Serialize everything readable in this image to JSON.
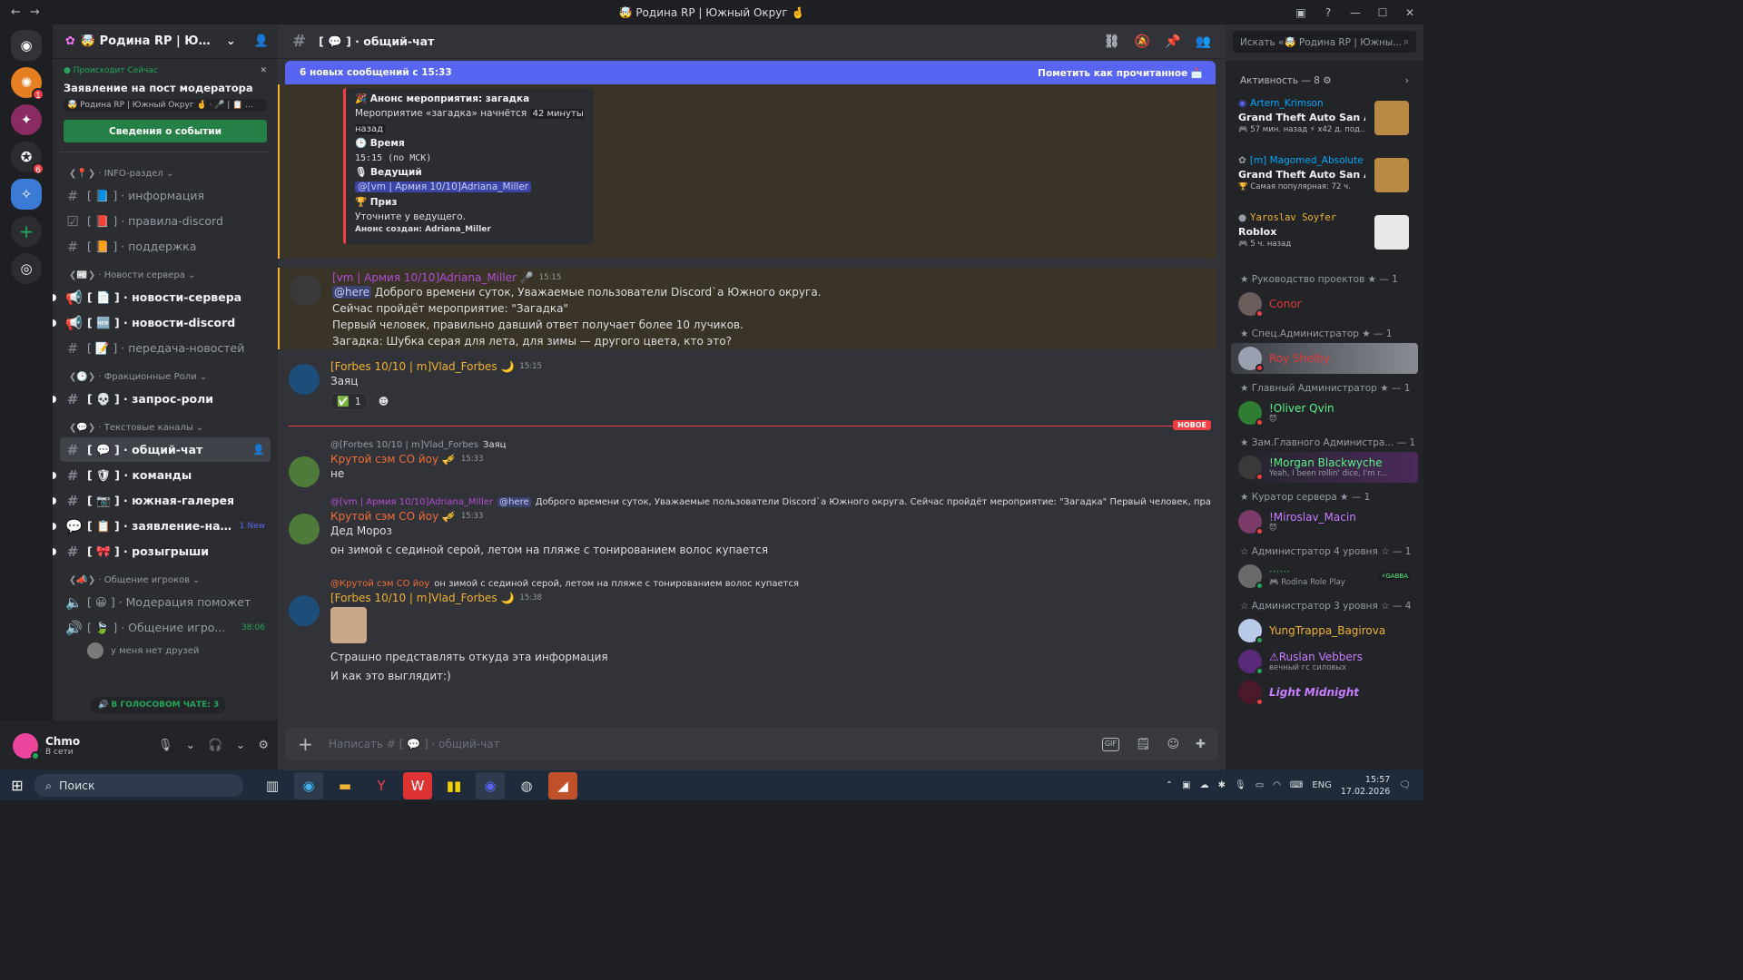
{
  "window": {
    "title": "🤯 Родина RP | Южный Округ 🤞",
    "back": "←",
    "forward": "→",
    "inbox_icon": "inbox-icon",
    "help_icon": "help-icon",
    "minimize": "—",
    "maximize": "☐",
    "close": "✕"
  },
  "guilds": [
    {
      "icon": "discord-home-icon",
      "glyph": "◉",
      "color": "#1e1f22",
      "badge": ""
    },
    {
      "icon": "server-orange-icon",
      "glyph": "✺",
      "color": "#e67e22",
      "badge": "1"
    },
    {
      "icon": "server-anime-icon",
      "glyph": "✦",
      "color": "#8a2c63",
      "badge": ""
    },
    {
      "icon": "server-circle-icon",
      "glyph": "✪",
      "color": "#2b2d31",
      "badge": "6"
    },
    {
      "icon": "server-rodina-icon",
      "glyph": "✧",
      "color": "#3b7bd6",
      "badge": ""
    },
    {
      "icon": "add-server-icon",
      "glyph": "+",
      "color": "#2b2d31",
      "badge": ""
    },
    {
      "icon": "discover-icon",
      "glyph": "◎",
      "color": "#2b2d31",
      "badge": ""
    }
  ],
  "server": {
    "name": "🤯 Родина RP | Южный ...",
    "dropdown": "⌄",
    "invite": "👤"
  },
  "event": {
    "live": "● Происходит Сейчас",
    "close": "✕",
    "title": "Заявление на пост модератора",
    "location": "🤯 Родина RP | Южный Округ 🤞 · 🎤 | 📋 ...",
    "button": "Сведения о событии"
  },
  "categories": {
    "info": "❮📍❯ · INFO-раздел ⌄",
    "news": "❮📰❯ · Новости сервера ⌄",
    "faction": "❮🕒❯ · Фракционные Роли ⌄",
    "text": "❮💬❯ · Текстовые каналы ⌄",
    "players": "❮📣❯ · Общение игроков ⌄"
  },
  "channels": {
    "info": "[ 📘 ] · информация",
    "rules": "[ 📕 ] · правила-discord",
    "support": "[ 📙 ] · поддержка",
    "server_news": "[ 📄 ] · новости-сервера",
    "discord_news": "[ 🆕 ] · новости-discord",
    "news_transfer": "[ 📝 ] · передача-новостей",
    "role_request": "[ 💀 ] · запрос-роли",
    "general": "[ 💬 ] · общий-чат",
    "teams": "[ 🛡 ] · команды",
    "gallery": "[ 📷 ] · южная-галерея",
    "application": "[ 📋 ] · заявление-на-п...",
    "application_new": "1 New",
    "giveaways": "[ 🎀 ] · розыгрыши",
    "moderation": "[ 😀 ] · Модерация поможет",
    "players_voice": "[ 🍃 ] · Общение игро...",
    "players_time": "38:06",
    "no_friends": "у меня нет друзей",
    "voice_pill": "🔊 В ГОЛОСОВОМ ЧАТЕ: 3"
  },
  "user": {
    "name": "Chmo",
    "status": "В сети",
    "mic": "🎙",
    "headset": "🎧",
    "settings": "⚙"
  },
  "chat": {
    "channel": "[ 💬 ] · общий-чат",
    "new_messages": "6 новых сообщений с 15:33",
    "mark_read": "Пометить как прочитанное 📩",
    "embed": {
      "title": "🎉 Анонс мероприятия: загадка",
      "line1": "Мероприятие «загадка» начнётся",
      "line1_ago": "42 минуты назад",
      "time_label": "🕒 Время",
      "time_value": "15:15 (по МСК)",
      "host_label": "🎙 Ведущий",
      "host_value": "@[vm | Армия 10/10]Adriana_Miller",
      "prize_label": "🏆 Приз",
      "prize_value": "Уточните у ведущего.",
      "footer": "Анонс создан: Adriana_Miller"
    },
    "msg1": {
      "author": "[vm | Армия 10/10]Adriana_Miller 🎤",
      "time": "15:15",
      "here": "@here",
      "line1": " Доброго времени суток, Уважаемые пользователи Discord`а Южного округа.",
      "line2": "Сейчас пройдёт мероприятие: \"Загадка\"",
      "line3": "Первый человек, правильно давший ответ получает более 10 лучиков.",
      "line4": "Загадка: Шубка серая для лета, для зимы — другого цвета, кто это?"
    },
    "msg2": {
      "author": "[Forbes 10/10 | m]Vlad_Forbes 🌙",
      "time": "15:15",
      "text": "Заяц",
      "reaction": "✅",
      "reaction_count": "1",
      "add_reaction": "☻"
    },
    "new_label": "НОВОЕ",
    "msg3": {
      "reply_to": "@[Forbes 10/10 | m]Vlad_Forbes",
      "reply_text": "Заяц",
      "author": "Крутой сэм СО йоу 🎺",
      "time": "15:33",
      "text": "не"
    },
    "msg4": {
      "reply_to": "@[vm | Армия 10/10]Adriana_Miller",
      "reply_here": "@here",
      "reply_text": " Доброго времени суток, Уважаемые пользователи Discord`а Южного округа. Сейчас пройдёт мероприятие: \"Загадка\" Первый человек, прав...",
      "author": "Крутой сэм СО йоу 🎺",
      "time": "15:33",
      "line1": "Дед Мороз",
      "line2": "он зимой с сединой серой, летом на пляже с тонированием волос купается"
    },
    "msg5": {
      "reply_to": "@Крутой сэм СО йоу",
      "reply_text": "он зимой с сединой серой, летом на пляже с тонированием волос купается",
      "author": "[Forbes 10/10 | m]Vlad_Forbes 🌙",
      "time": "15:38",
      "line1": "Страшно представлять откуда эта информация",
      "line2": "И как это выглядит:)"
    },
    "composer_placeholder": "Написать # [ 💬 ] · общий-чат",
    "composer_plus": "+",
    "gif": "GIF",
    "sticker": "🗒",
    "emoji": "☺",
    "apps": "✚"
  },
  "right": {
    "search": "Искать «🤯 Родина RP | Южны...",
    "search_icon": "⌕",
    "activity_title": "Активность — 8 ⚙",
    "activity_chevron": "›",
    "cards": [
      {
        "who": "Artem_Krimson",
        "game": "Grand Theft Auto San Andr...",
        "meta": "🎮 57 мин. назад  ⚡ x42 д. под..."
      },
      {
        "who": "[m] Magomed_Absolute",
        "game": "Grand Theft Auto San Andr...",
        "meta": "🏆 Самая популярная: 72 ч."
      },
      {
        "who": "Yaroslav Soyfer",
        "game": "Roblox",
        "meta": "🎮 5 ч. назад"
      }
    ],
    "roles": [
      {
        "title": "★ Руководство проектов ★ — 1",
        "members": [
          {
            "name": "Conor",
            "sub": "",
            "color": "#e03a3a"
          }
        ]
      },
      {
        "title": "★ Спец.Администратор ★ — 1",
        "members": [
          {
            "name": "Roy Shelby",
            "sub": "",
            "color": "#e03a3a"
          }
        ]
      },
      {
        "title": "★ Главный Администратор ★ — 1",
        "members": [
          {
            "name": "!Oliver Qvin",
            "sub": "😈",
            "color": "#57f287"
          }
        ]
      },
      {
        "title": "★ Зам.Главного Администра... — 1",
        "members": [
          {
            "name": "!Morgan Blackwyche",
            "sub": "Yeah, I been rollin' dice, I'm r...",
            "color": "#57f287"
          }
        ]
      },
      {
        "title": "★ Куратор сервера ★ — 1",
        "members": [
          {
            "name": "!Miroslav_Macin",
            "sub": "😈",
            "color": "#c77dff"
          }
        ]
      },
      {
        "title": "☆ Администратор 4 уровня ☆ — 1",
        "members": [
          {
            "name": "······",
            "sub": "🎮 Rodina Role Play",
            "color": "#3ba55c"
          }
        ]
      },
      {
        "title": "☆ Администратор 3 уровня ☆ — 4",
        "members": [
          {
            "name": "YungTrappa_Bagirova",
            "sub": "",
            "color": "#f0b232"
          },
          {
            "name": "⚠Ruslan Vebbers",
            "sub": "вечный гс силовых",
            "color": "#c77dff"
          },
          {
            "name": "Light Midnight",
            "sub": "",
            "color": "#c77dff"
          }
        ]
      }
    ]
  },
  "taskbar": {
    "start": "⊞",
    "search": "Поиск",
    "search_icon": "⌕",
    "lang": "ENG",
    "time": "15:57",
    "date": "17.02.2026"
  }
}
